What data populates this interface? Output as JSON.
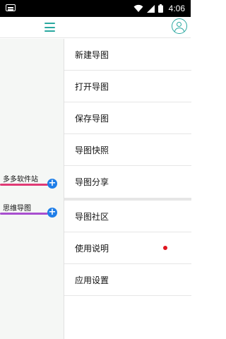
{
  "status_bar": {
    "time": "4:06",
    "icons": [
      "keyboard-icon",
      "wifi-icon",
      "signal-icon",
      "battery-icon"
    ]
  },
  "app_bar": {
    "accent_color": "#2aa8a0",
    "icons": [
      "menu-icon",
      "user-icon"
    ]
  },
  "canvas": {
    "nodes": [
      {
        "label": "多多软件站",
        "line_color": "#e03a75"
      },
      {
        "label": "思维导图",
        "line_color": "#a84fcf"
      }
    ],
    "add_button_color": "#1f7ee8"
  },
  "drawer": {
    "items": [
      {
        "label": "新建导图"
      },
      {
        "label": "打开导图"
      },
      {
        "label": "保存导图"
      },
      {
        "label": "导图快照"
      },
      {
        "label": "导图分享"
      },
      {
        "label": "导图社区"
      },
      {
        "label": "使用说明",
        "badge_color": "#e0141e"
      },
      {
        "label": "应用设置"
      }
    ]
  }
}
